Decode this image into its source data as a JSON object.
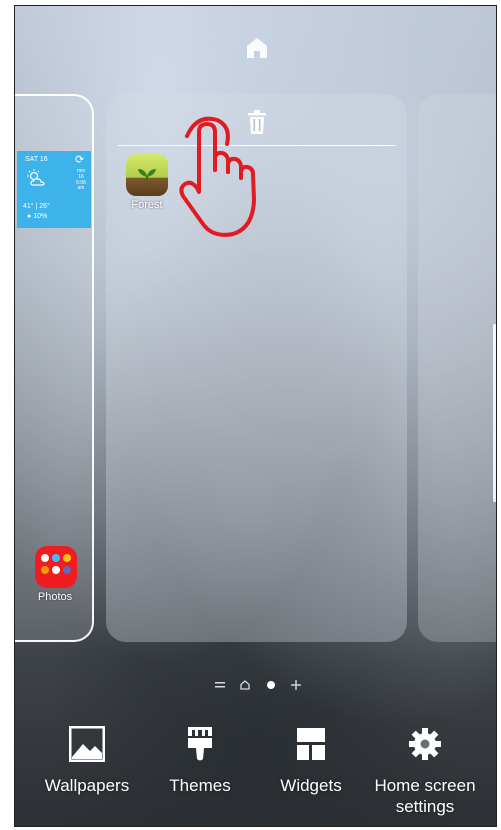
{
  "top": {
    "home_icon": "home-icon"
  },
  "left_panel": {
    "weather": {
      "day": "SAT 16",
      "update_line1": "nov",
      "update_line2": "16",
      "update_line3": "6:06",
      "update_line4": "am",
      "temps": "41° | 26°",
      "rain": "10%"
    },
    "photos_label": "Photos"
  },
  "center_panel": {
    "trash_icon": "trash-icon",
    "apps": [
      {
        "label": "Forest",
        "icon": "forest-icon"
      }
    ]
  },
  "overlay": {
    "hand_icon": "pointer-hand-icon",
    "color": "#e11b22"
  },
  "page_indicator": [
    "menu",
    "home",
    "current",
    "add"
  ],
  "bottom_bar": {
    "items": [
      {
        "label": "Wallpapers",
        "icon": "wallpapers-icon"
      },
      {
        "label": "Themes",
        "icon": "themes-brush-icon"
      },
      {
        "label": "Widgets",
        "icon": "widgets-icon"
      },
      {
        "label": "Home screen settings",
        "icon": "gear-icon"
      }
    ]
  }
}
